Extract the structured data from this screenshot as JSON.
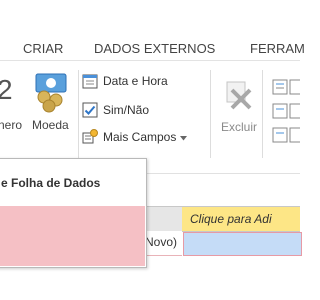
{
  "tabs": [
    "CRIAR",
    "DADOS EXTERNOS",
    "FERRAM"
  ],
  "ribbon": {
    "numero_label": "nero",
    "numero_digit": "2",
    "moeda_label": "Moeda",
    "data_hora_label": "Data e Hora",
    "sim_nao_label": "Sim/Não",
    "mais_campos_label": "Mais Campos",
    "excluir_label": "Excluir"
  },
  "dropdown": {
    "title": "e Folha de Dados"
  },
  "grid": {
    "header_click_label": "Clique para Adi",
    "row_label": "(Novo)"
  },
  "colors": {
    "accent_pink": "#f5c0c5",
    "header_yellow": "#fde686",
    "selection_blue": "#c5dcf7"
  }
}
